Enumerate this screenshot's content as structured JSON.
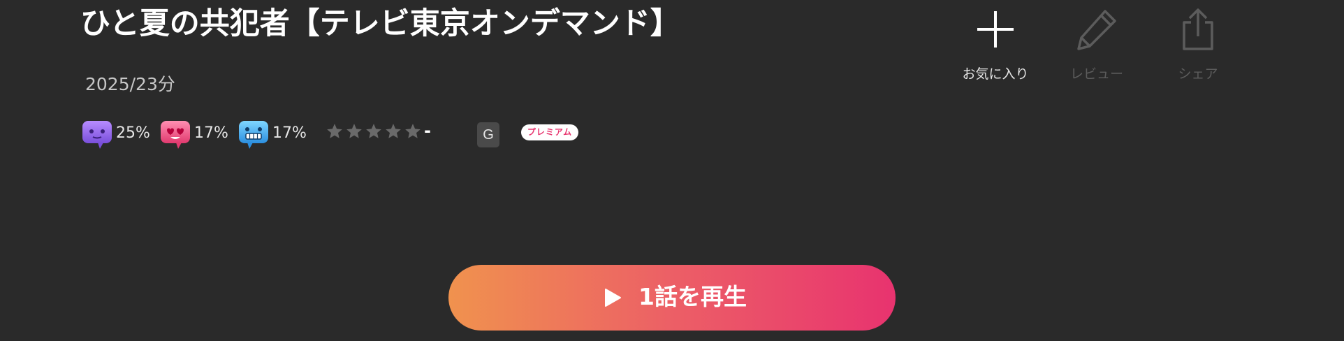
{
  "title": "ひと夏の共犯者【テレビ東京オンデマンド】",
  "meta": "2025/23分",
  "reactions": [
    {
      "icon": "purple-face-speech-bubble-icon",
      "color": "#9a6bf0",
      "percent": "25%"
    },
    {
      "icon": "heart-eyes-speech-bubble-icon",
      "color": "#f0528a",
      "percent": "17%"
    },
    {
      "icon": "grimace-speech-bubble-icon",
      "color": "#3fb4ef",
      "percent": "17%"
    }
  ],
  "rating": {
    "stars_filled": 0,
    "stars_total": 5,
    "score": "-"
  },
  "age_rating": "G",
  "premium_label": "プレミアム",
  "actions": [
    {
      "icon": "plus-icon",
      "label": "お気に入り",
      "enabled": true
    },
    {
      "icon": "pencil-icon",
      "label": "レビュー",
      "enabled": false
    },
    {
      "icon": "share-icon",
      "label": "シェア",
      "enabled": false
    }
  ],
  "play_button": {
    "icon": "play-icon",
    "label": "1話を再生"
  },
  "colors": {
    "background": "#2a2a2a",
    "play_gradient_start": "#f0924e",
    "play_gradient_end": "#e8336f",
    "premium_text": "#e8366f",
    "star_empty": "#6a6a6a",
    "disabled": "#5c5c5c"
  }
}
